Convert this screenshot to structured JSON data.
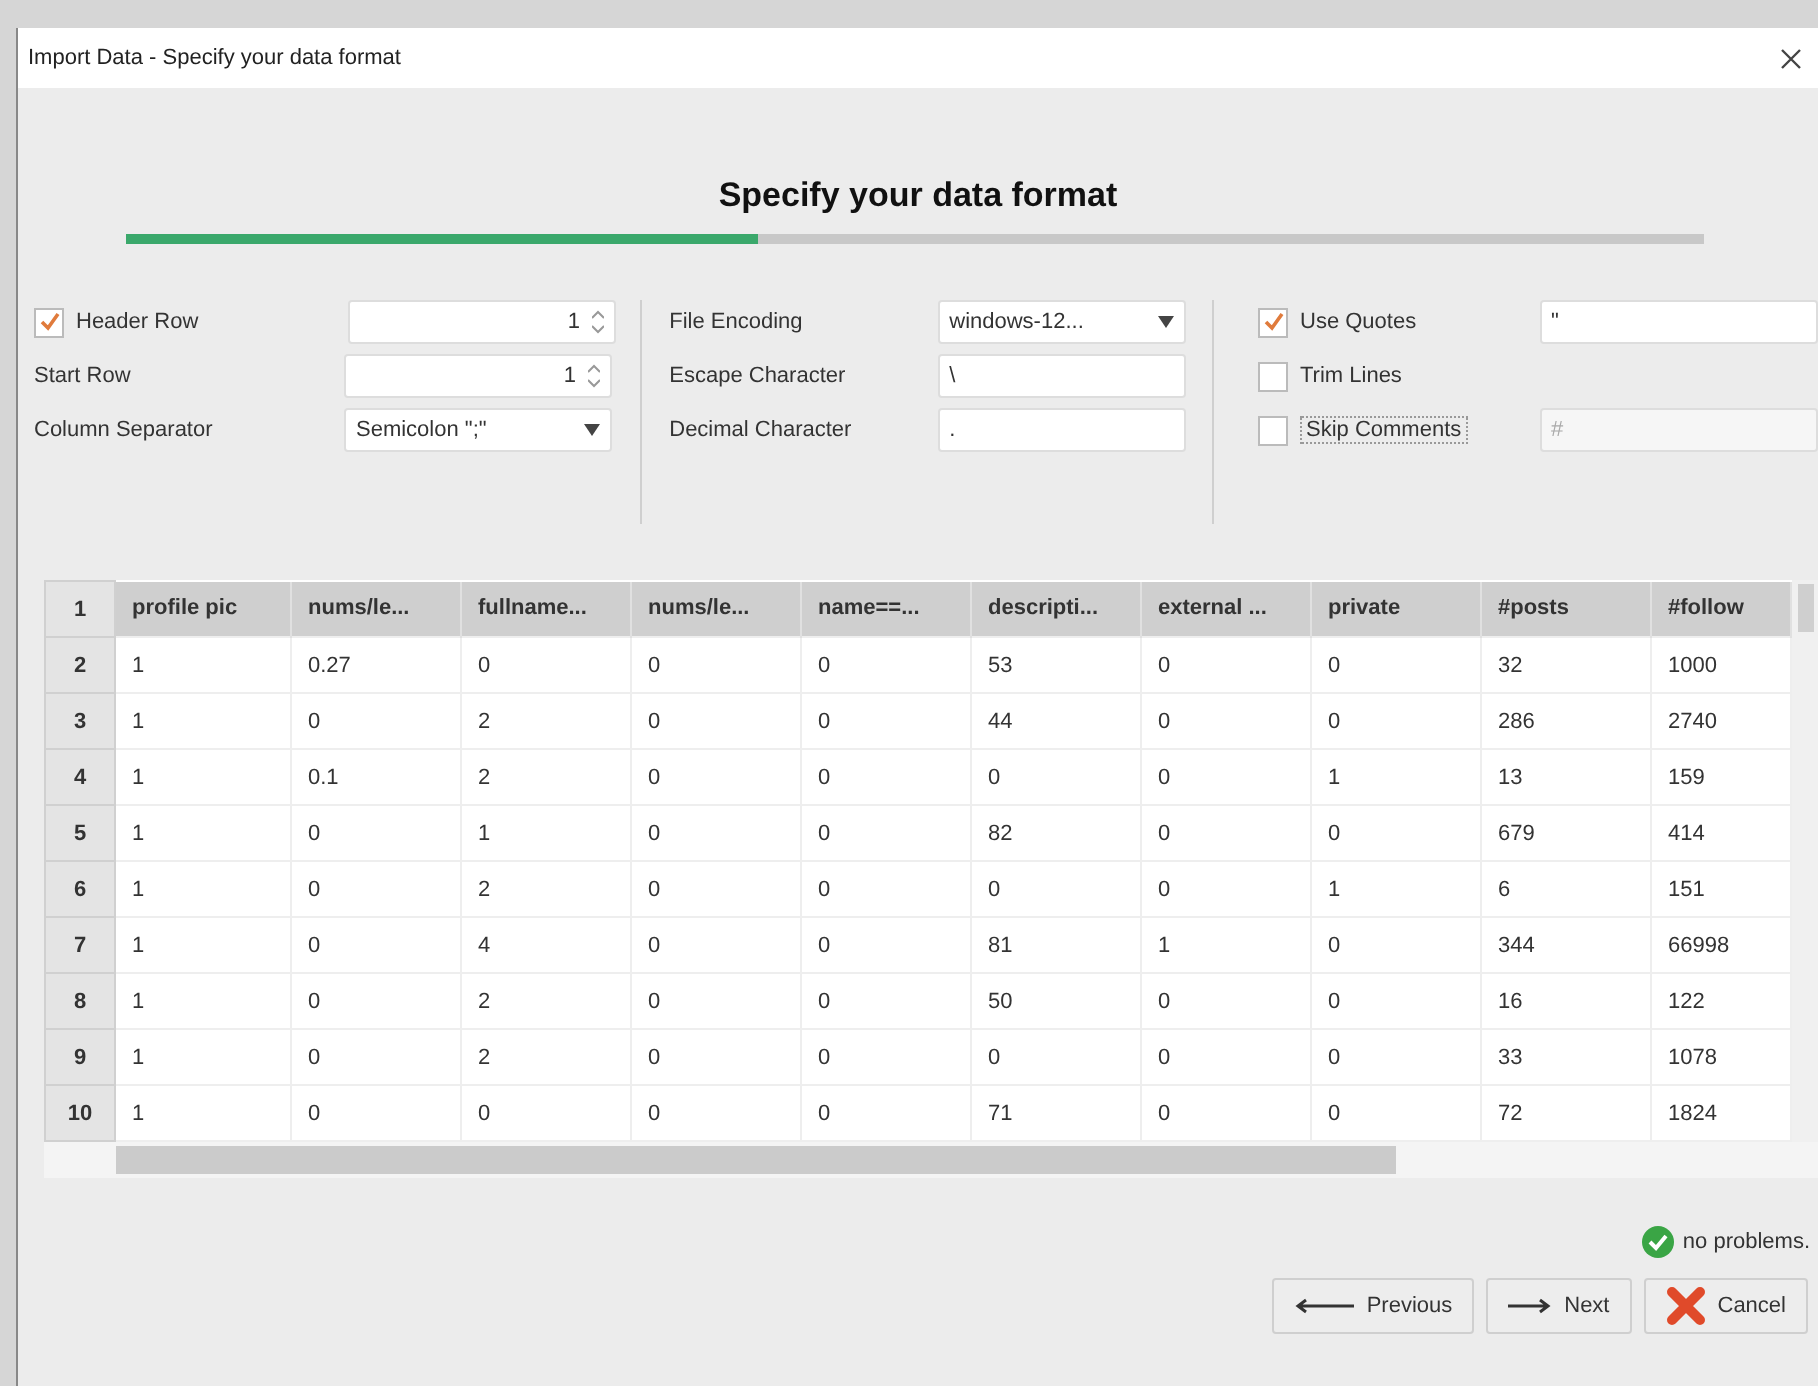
{
  "window": {
    "title": "Import Data - Specify your data format"
  },
  "heading": "Specify your data format",
  "progress": {
    "level": 0.4
  },
  "options": [
    {
      "kind": "spinner",
      "label": "Header Row",
      "checkbox": true,
      "checked": true,
      "value": "1"
    },
    {
      "kind": "spinner",
      "label": "Start Row",
      "checkbox": false,
      "value": "1"
    },
    {
      "kind": "dropdown",
      "label": "Column Separator",
      "checkbox": false,
      "value": "Semicolon \";\""
    }
  ],
  "options_2": [
    {
      "kind": "dropdown",
      "label": "File Encoding",
      "value": "windows-12..."
    },
    {
      "kind": "text",
      "label": "Escape Character",
      "value": "\\"
    },
    {
      "kind": "text",
      "label": "Decimal Character",
      "value": "."
    }
  ],
  "options_3": [
    {
      "kind": "text",
      "label": "Use Quotes",
      "checked": true,
      "value": "\"",
      "disabled": false
    },
    {
      "kind": "none",
      "label": "Trim Lines",
      "checked": false
    },
    {
      "kind": "text",
      "label": "Skip Comments",
      "checked": false,
      "value": "#",
      "disabled": true
    }
  ],
  "table": {
    "header_index": "1",
    "columns": [
      "profile pic",
      "nums/le...",
      "fullname...",
      "nums/le...",
      "name==...",
      "descripti...",
      "external ...",
      "private",
      "#posts",
      "#follow"
    ],
    "rows": [
      {
        "index": "2",
        "cells": [
          "1",
          "0.27",
          "0",
          "0",
          "0",
          "53",
          "0",
          "0",
          "32",
          "1000"
        ]
      },
      {
        "index": "3",
        "cells": [
          "1",
          "0",
          "2",
          "0",
          "0",
          "44",
          "0",
          "0",
          "286",
          "2740"
        ]
      },
      {
        "index": "4",
        "cells": [
          "1",
          "0.1",
          "2",
          "0",
          "0",
          "0",
          "0",
          "1",
          "13",
          "159"
        ]
      },
      {
        "index": "5",
        "cells": [
          "1",
          "0",
          "1",
          "0",
          "0",
          "82",
          "0",
          "0",
          "679",
          "414"
        ]
      },
      {
        "index": "6",
        "cells": [
          "1",
          "0",
          "2",
          "0",
          "0",
          "0",
          "0",
          "1",
          "6",
          "151"
        ]
      },
      {
        "index": "7",
        "cells": [
          "1",
          "0",
          "4",
          "0",
          "0",
          "81",
          "1",
          "0",
          "344",
          "66998"
        ]
      },
      {
        "index": "8",
        "cells": [
          "1",
          "0",
          "2",
          "0",
          "0",
          "50",
          "0",
          "0",
          "16",
          "122"
        ]
      },
      {
        "index": "9",
        "cells": [
          "1",
          "0",
          "2",
          "0",
          "0",
          "0",
          "0",
          "0",
          "33",
          "1078"
        ]
      },
      {
        "index": "10",
        "cells": [
          "1",
          "0",
          "0",
          "0",
          "0",
          "71",
          "0",
          "0",
          "72",
          "1824"
        ]
      }
    ]
  },
  "status": {
    "ok": true,
    "text": "no problems."
  },
  "buttons": [
    {
      "kind": "previous",
      "label": "Previous"
    },
    {
      "kind": "next",
      "label": "Next"
    },
    {
      "kind": "cancel",
      "label": "Cancel"
    }
  ]
}
